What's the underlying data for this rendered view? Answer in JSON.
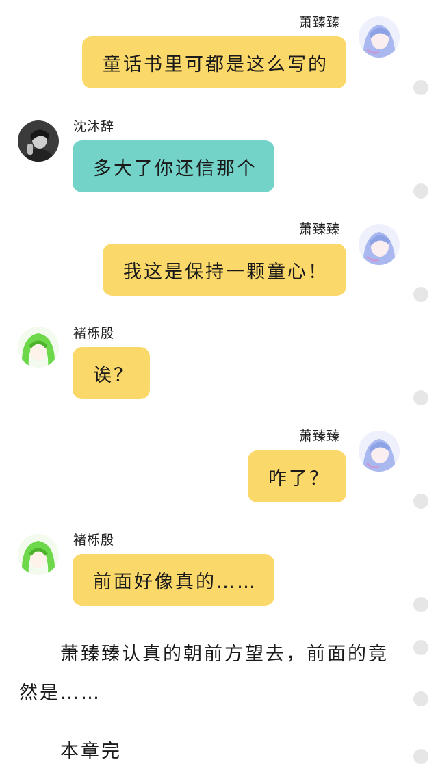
{
  "messages": [
    {
      "sender": "萧臻臻",
      "text": "童话书里可都是这么写的"
    },
    {
      "sender": "沈沐辞",
      "text": "多大了你还信那个"
    },
    {
      "sender": "萧臻臻",
      "text": "我这是保持一颗童心！"
    },
    {
      "sender": "褚栎殷",
      "text": "诶？"
    },
    {
      "sender": "萧臻臻",
      "text": "咋了？"
    },
    {
      "sender": "褚栎殷",
      "text": "前面好像真的……"
    }
  ],
  "narration": {
    "line1": "萧臻臻认真的朝前方望去，前面的竟",
    "line2": "然是……",
    "chapter_end": "本章完"
  },
  "colors": {
    "bubble_yellow": "#fbd86a",
    "bubble_teal": "#74d3c8"
  }
}
